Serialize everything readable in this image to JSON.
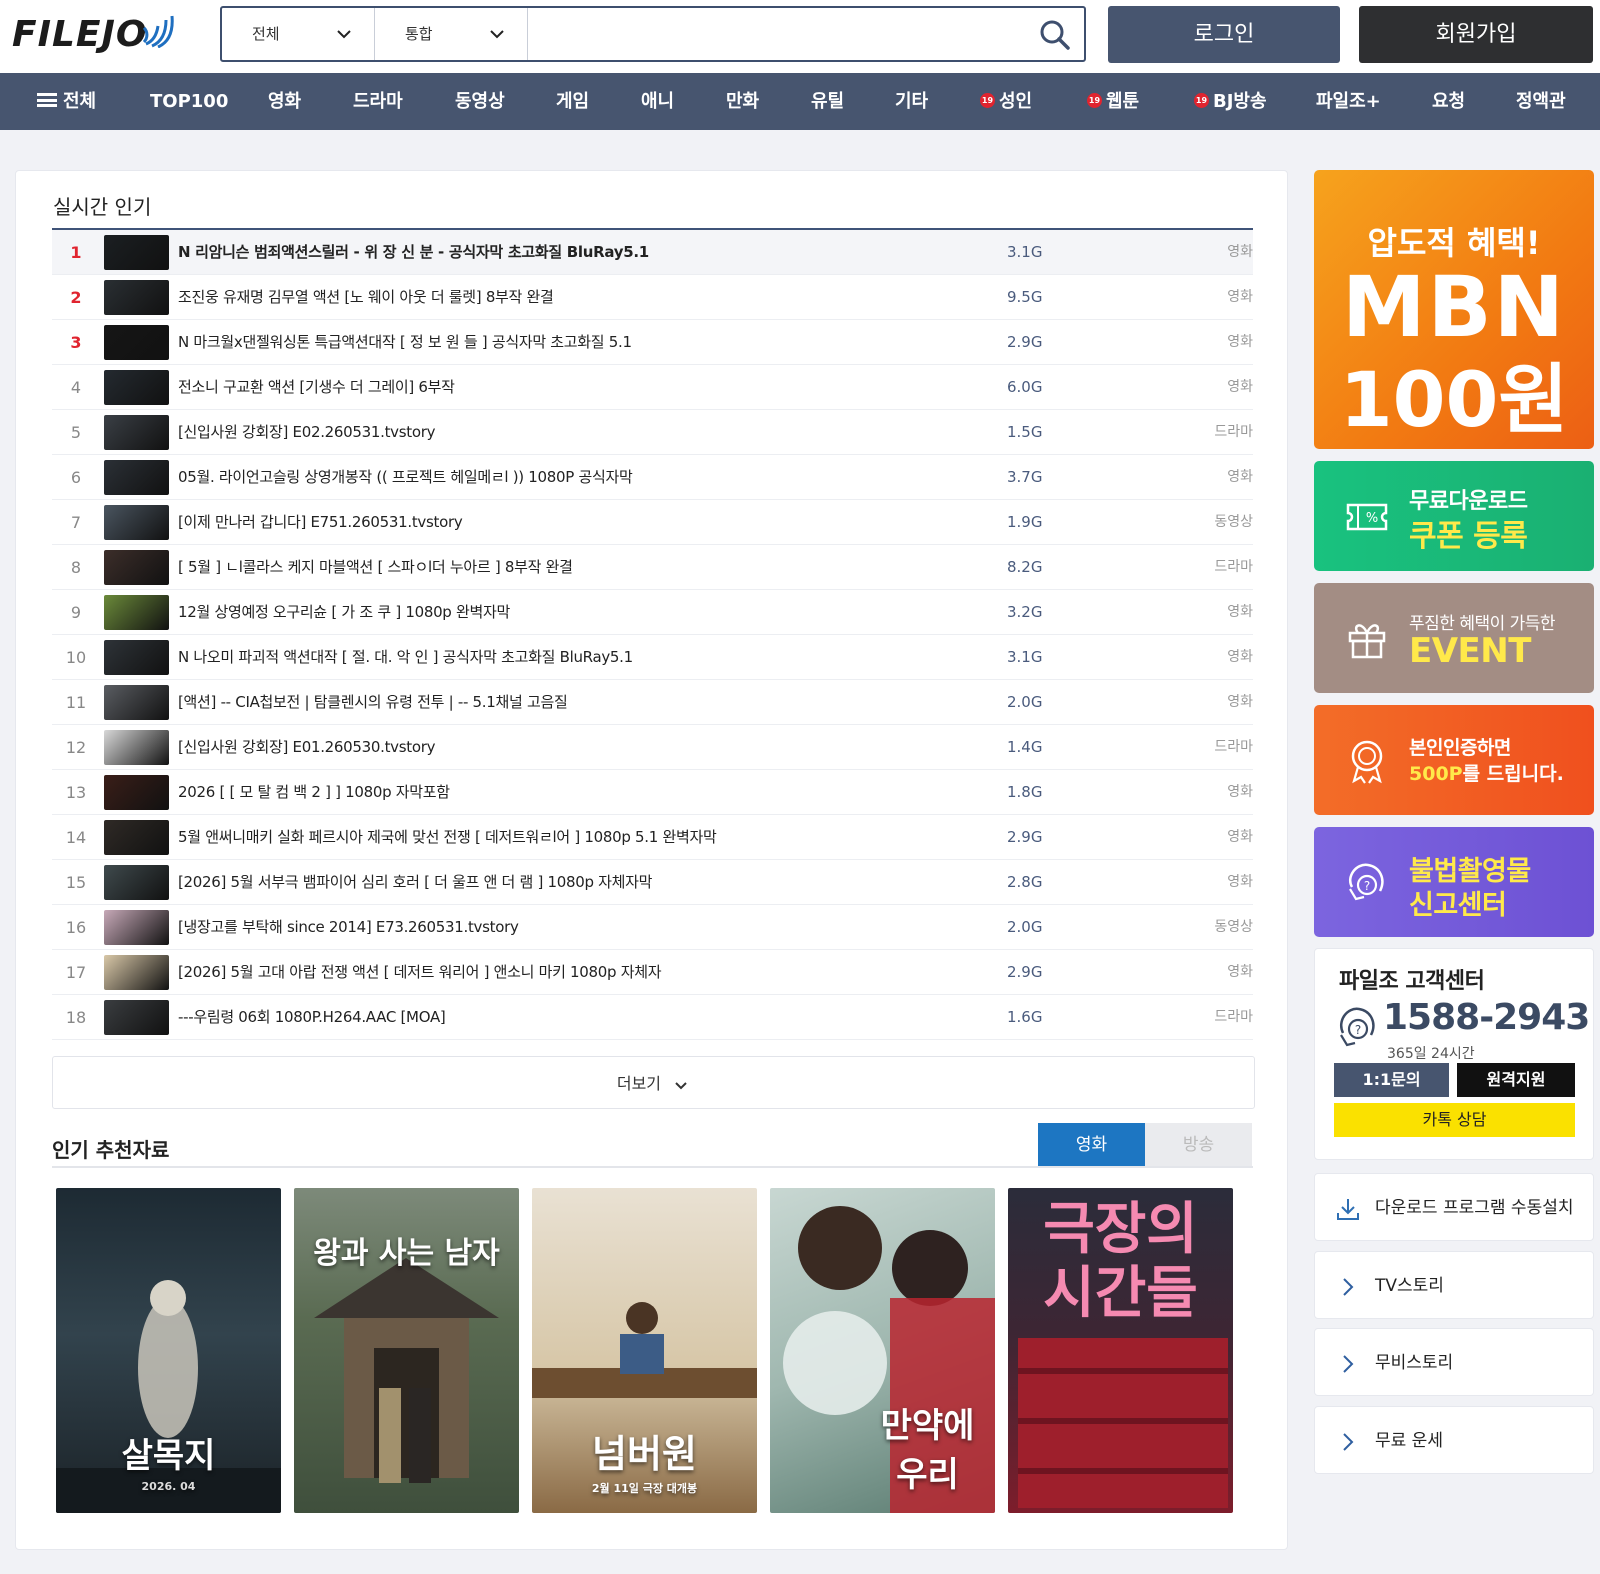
{
  "header": {
    "logo_text": "FILEJO",
    "search": {
      "select1": "전체",
      "select2": "통합",
      "query": "",
      "placeholder": ""
    },
    "login_label": "로그인",
    "join_label": "회원가입",
    "colors": {
      "primary": "#47556f",
      "dark": "#2e2f31"
    }
  },
  "nav": {
    "items": [
      {
        "label": "전체"
      },
      {
        "label": "TOP100"
      },
      {
        "label": "영화"
      },
      {
        "label": "드라마"
      },
      {
        "label": "동영상"
      },
      {
        "label": "게임"
      },
      {
        "label": "애니"
      },
      {
        "label": "만화"
      },
      {
        "label": "유틸"
      },
      {
        "label": "기타"
      },
      {
        "label": "성인",
        "badge": "19"
      },
      {
        "label": "웹툰",
        "badge": "19"
      },
      {
        "label": "BJ방송",
        "badge": "19"
      },
      {
        "label": "파일조+"
      },
      {
        "label": "요청"
      },
      {
        "label": "정액관"
      }
    ]
  },
  "realtime": {
    "title": "실시간 인기",
    "items": [
      {
        "rank": "1",
        "title": "N 리암니슨 범죄액션스릴러 - 위 장 신 분 - 공식자막 초고화질 BluRay5.1",
        "size": "3.1G",
        "category": "영화"
      },
      {
        "rank": "2",
        "title": "조진웅 유재명 김무열 액션 [노 웨이 아웃 더 룰렛] 8부작 완결",
        "size": "9.5G",
        "category": "영화"
      },
      {
        "rank": "3",
        "title": "N 마크월x댄젤워싱톤 특급액션대작 [ 정 보 원 들 ] 공식자막 초고화질 5.1",
        "size": "2.9G",
        "category": "영화"
      },
      {
        "rank": "4",
        "title": "전소니 구교환 액션 [기생수 더 그레이] 6부작",
        "size": "6.0G",
        "category": "영화"
      },
      {
        "rank": "5",
        "title": "[신입사원 강회장] E02.260531.tvstory",
        "size": "1.5G",
        "category": "드라마"
      },
      {
        "rank": "6",
        "title": "05월. 라이언고슬링 상영개봉작 (( 프로젝트 헤일메ㄹl )) 1080P 공식자막",
        "size": "3.7G",
        "category": "영화"
      },
      {
        "rank": "7",
        "title": "[이제 만나러 갑니다] E751.260531.tvstory",
        "size": "1.9G",
        "category": "동영상"
      },
      {
        "rank": "8",
        "title": "[ 5월 ] ㄴl콜라스 케지 마블액션 [ 스파ㅇl더 누아르 ] 8부작 완결",
        "size": "8.2G",
        "category": "드라마"
      },
      {
        "rank": "9",
        "title": "12월 상영예정 오구리슌 [ 가 조 쿠 ] 1080p 완벽자막",
        "size": "3.2G",
        "category": "영화"
      },
      {
        "rank": "10",
        "title": "N 나오미 파괴적 액션대작 [ 절. 대. 악 인 ] 공식자막 초고화질 BluRay5.1",
        "size": "3.1G",
        "category": "영화"
      },
      {
        "rank": "11",
        "title": "[액션] -- CIA첩보전 | 탐클렌시의 유령 전투 |  -- 5.1채널 고음질",
        "size": "2.0G",
        "category": "영화"
      },
      {
        "rank": "12",
        "title": "[신입사원 강회장] E01.260530.tvstory",
        "size": "1.4G",
        "category": "드라마"
      },
      {
        "rank": "13",
        "title": "2026 [ [ 모 탈 컴 백 2 ] ] 1080p 자막포함",
        "size": "1.8G",
        "category": "영화"
      },
      {
        "rank": "14",
        "title": "5월 앤써니매키 실화 페르시아 제국에 맞선 전쟁 [ 데저트워ㄹl어 ] 1080p 5.1 완벽자막",
        "size": "2.9G",
        "category": "영화"
      },
      {
        "rank": "15",
        "title": "[2026] 5월 서부극 뱀파이어 심리 호러 [ 더 울프 앤 더 램 ] 1080p 자체자막",
        "size": "2.8G",
        "category": "영화"
      },
      {
        "rank": "16",
        "title": "[냉장고를 부탁해 since 2014] E73.260531.tvstory",
        "size": "2.0G",
        "category": "동영상"
      },
      {
        "rank": "17",
        "title": "[2026] 5월 고대 아랍 전쟁 액션 [ 데저트 워리어 ] 앤소니 마키 1080p 자체자",
        "size": "2.9G",
        "category": "영화"
      },
      {
        "rank": "18",
        "title": "---우림령 06회 1080P.H264.AAC [MOA]",
        "size": "1.6G",
        "category": "드라마"
      }
    ],
    "more_label": "더보기"
  },
  "recommend": {
    "title": "인기 추천자료",
    "tabs": [
      {
        "label": "영화"
      },
      {
        "label": "방송"
      }
    ],
    "posters": [
      {
        "title": "살목지",
        "sub": "2026. 04"
      },
      {
        "title": "왕과 사는 남자",
        "sub": ""
      },
      {
        "title": "넘버원",
        "sub": "2월 11일 극장 대개봉"
      },
      {
        "title": "만약에 우리",
        "sub": ""
      },
      {
        "title": "극장의 시간들",
        "sub": ""
      }
    ]
  },
  "sidebar": {
    "mbn": {
      "line1": "압도적 혜택!",
      "line2": "MBN",
      "line3": "100원"
    },
    "coupon": {
      "line1": "무료다운로드",
      "line2": "쿠폰 등록"
    },
    "event": {
      "line1": "푸짐한 혜택이 가득한",
      "line2": "EVENT"
    },
    "cert": {
      "line1": "본인인증하면",
      "line2a": "500P",
      "line2b": "를 드립니다."
    },
    "report": {
      "line1": "불법촬영물",
      "line2": "신고센터"
    },
    "cs": {
      "title": "파일조 고객센터",
      "phone": "1588-2943",
      "hours": "365일 24시간",
      "inquiry": "1:1문의",
      "remote": "원격지원",
      "kakao": "카톡 상담"
    },
    "links": [
      {
        "label": "다운로드 프로그램 수동설치",
        "icon": "download-icon"
      },
      {
        "label": "TV스토리",
        "icon": "chevron-right-icon"
      },
      {
        "label": "무비스토리",
        "icon": "chevron-right-icon"
      },
      {
        "label": "무료 운세",
        "icon": "chevron-right-icon"
      }
    ]
  }
}
